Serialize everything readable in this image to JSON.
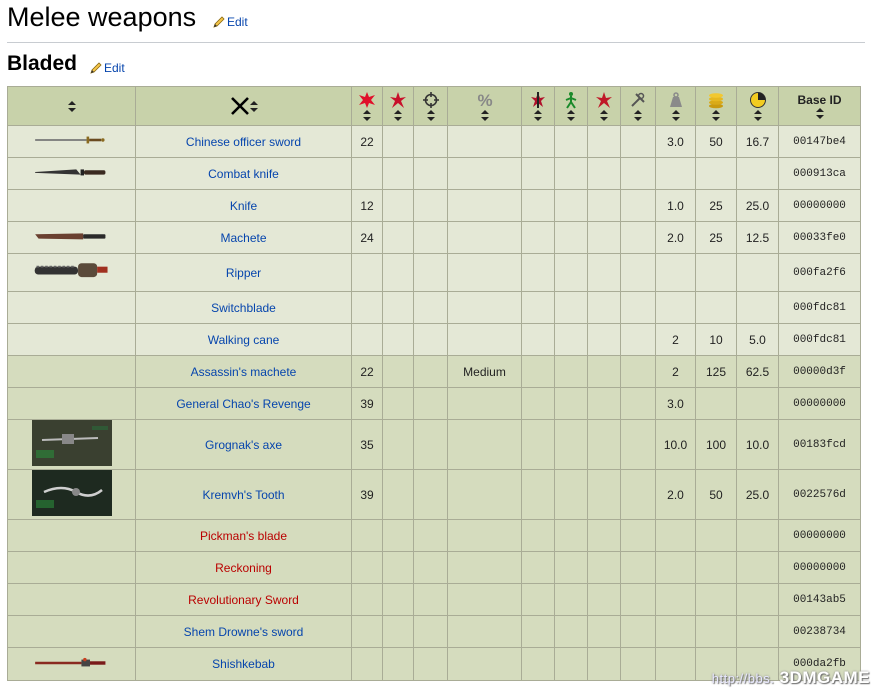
{
  "heading": {
    "title": "Melee weapons",
    "edit_label": "Edit"
  },
  "section": {
    "title": "Bladed",
    "edit_label": "Edit"
  },
  "table": {
    "header_base_id": "Base ID",
    "header_icons": [
      "damage-icon",
      "critical-damage-icon",
      "accuracy-icon",
      "percent-icon",
      "bleed-icon",
      "action-points-icon",
      "limb-damage-icon",
      "wrench-icon",
      "weight-icon",
      "value-coins-icon",
      "speed-icon"
    ],
    "rows": [
      {
        "image": "sword",
        "name": "Chinese officer sword",
        "color": "blue",
        "dmg": "22",
        "c2": "",
        "c3": "",
        "c4": "",
        "c5": "",
        "c6": "",
        "c7": "",
        "c8": "",
        "weight": "3.0",
        "value": "50",
        "spd": "16.7",
        "id": "00147be4",
        "bg": "a"
      },
      {
        "image": "knife",
        "name": "Combat knife",
        "color": "blue",
        "dmg": "",
        "c2": "",
        "c3": "",
        "c4": "",
        "c5": "",
        "c6": "",
        "c7": "",
        "c8": "",
        "weight": "",
        "value": "",
        "spd": "",
        "id": "000913ca",
        "bg": "a"
      },
      {
        "image": "",
        "name": "Knife",
        "color": "blue",
        "dmg": "12",
        "c2": "",
        "c3": "",
        "c4": "",
        "c5": "",
        "c6": "",
        "c7": "",
        "c8": "",
        "weight": "1.0",
        "value": "25",
        "spd": "25.0",
        "id": "00000000",
        "bg": "a"
      },
      {
        "image": "machete",
        "name": "Machete",
        "color": "blue",
        "dmg": "24",
        "c2": "",
        "c3": "",
        "c4": "",
        "c5": "",
        "c6": "",
        "c7": "",
        "c8": "",
        "weight": "2.0",
        "value": "25",
        "spd": "12.5",
        "id": "00033fe0",
        "bg": "a"
      },
      {
        "image": "ripper",
        "name": "Ripper",
        "color": "blue",
        "dmg": "",
        "c2": "",
        "c3": "",
        "c4": "",
        "c5": "",
        "c6": "",
        "c7": "",
        "c8": "",
        "weight": "",
        "value": "",
        "spd": "",
        "id": "000fa2f6",
        "bg": "a"
      },
      {
        "image": "",
        "name": "Switchblade",
        "color": "blue",
        "dmg": "",
        "c2": "",
        "c3": "",
        "c4": "",
        "c5": "",
        "c6": "",
        "c7": "",
        "c8": "",
        "weight": "",
        "value": "",
        "spd": "",
        "id": "000fdc81",
        "bg": "a"
      },
      {
        "image": "",
        "name": "Walking cane",
        "color": "blue",
        "dmg": "",
        "c2": "",
        "c3": "",
        "c4": "",
        "c5": "",
        "c6": "",
        "c7": "",
        "c8": "",
        "weight": "2",
        "value": "10",
        "spd": "5.0",
        "id": "000fdc81",
        "bg": "a"
      },
      {
        "image": "",
        "name": "Assassin's machete",
        "color": "blue",
        "dmg": "22",
        "c2": "",
        "c3": "",
        "c4": "Medium",
        "c5": "",
        "c6": "",
        "c7": "",
        "c8": "",
        "weight": "2",
        "value": "125",
        "spd": "62.5",
        "id": "00000d3f",
        "bg": "b"
      },
      {
        "image": "",
        "name": "General Chao's Revenge",
        "color": "blue",
        "dmg": "39",
        "c2": "",
        "c3": "",
        "c4": "",
        "c5": "",
        "c6": "",
        "c7": "",
        "c8": "",
        "weight": "3.0",
        "value": "",
        "spd": "",
        "id": "00000000",
        "bg": "b"
      },
      {
        "image": "grognak",
        "name": "Grognak's axe",
        "color": "blue",
        "dmg": "35",
        "c2": "",
        "c3": "",
        "c4": "",
        "c5": "",
        "c6": "",
        "c7": "",
        "c8": "",
        "weight": "10.0",
        "value": "100",
        "spd": "10.0",
        "id": "00183fcd",
        "bg": "b"
      },
      {
        "image": "kremvh",
        "name": "Kremvh's Tooth",
        "color": "blue",
        "dmg": "39",
        "c2": "",
        "c3": "",
        "c4": "",
        "c5": "",
        "c6": "",
        "c7": "",
        "c8": "",
        "weight": "2.0",
        "value": "50",
        "spd": "25.0",
        "id": "0022576d",
        "bg": "b"
      },
      {
        "image": "",
        "name": "Pickman's blade",
        "color": "red",
        "dmg": "",
        "c2": "",
        "c3": "",
        "c4": "",
        "c5": "",
        "c6": "",
        "c7": "",
        "c8": "",
        "weight": "",
        "value": "",
        "spd": "",
        "id": "00000000",
        "bg": "b"
      },
      {
        "image": "",
        "name": "Reckoning",
        "color": "red",
        "dmg": "",
        "c2": "",
        "c3": "",
        "c4": "",
        "c5": "",
        "c6": "",
        "c7": "",
        "c8": "",
        "weight": "",
        "value": "",
        "spd": "",
        "id": "00000000",
        "bg": "b"
      },
      {
        "image": "",
        "name": "Revolutionary Sword",
        "color": "red",
        "dmg": "",
        "c2": "",
        "c3": "",
        "c4": "",
        "c5": "",
        "c6": "",
        "c7": "",
        "c8": "",
        "weight": "",
        "value": "",
        "spd": "",
        "id": "00143ab5",
        "bg": "b"
      },
      {
        "image": "",
        "name": "Shem Drowne's sword",
        "color": "blue",
        "dmg": "",
        "c2": "",
        "c3": "",
        "c4": "",
        "c5": "",
        "c6": "",
        "c7": "",
        "c8": "",
        "weight": "",
        "value": "",
        "spd": "",
        "id": "00238734",
        "bg": "b"
      },
      {
        "image": "shishkebab",
        "name": "Shishkebab",
        "color": "blue",
        "dmg": "",
        "c2": "",
        "c3": "",
        "c4": "",
        "c5": "",
        "c6": "",
        "c7": "",
        "c8": "",
        "weight": "",
        "value": "",
        "spd": "",
        "id": "000da2fb",
        "bg": "b"
      }
    ]
  },
  "watermark": {
    "url": "http://bbs.",
    "brand": "3DMGAME"
  },
  "colors": {
    "link": "#0645ad",
    "redlink": "#ba0000",
    "header_bg": "#c8d2aa",
    "row_light": "#e4e8d6",
    "row_dark": "#d5dcbe"
  }
}
